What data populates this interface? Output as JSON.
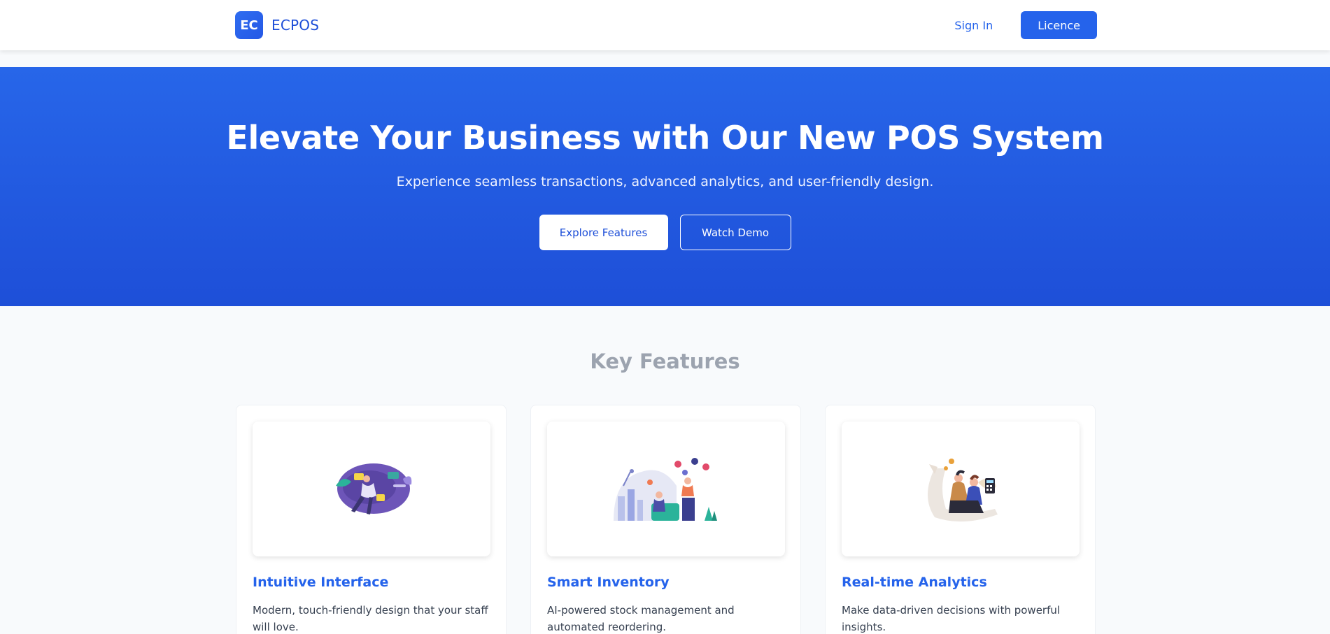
{
  "header": {
    "logo_text": "EC",
    "brand_name": "ECPOS",
    "sign_in_label": "Sign In",
    "licence_label": "Licence"
  },
  "hero": {
    "title": "Elevate Your Business with Our New POS System",
    "subtitle": "Experience seamless transactions, advanced analytics, and user-friendly design.",
    "primary_button": "Explore Features",
    "secondary_button": "Watch Demo"
  },
  "features": {
    "title": "Key Features",
    "items": [
      {
        "title": "Intuitive Interface",
        "description": "Modern, touch-friendly design that your staff will love.",
        "illustration": "person-floating-illustration"
      },
      {
        "title": "Smart Inventory",
        "description": "AI-powered stock management and automated reordering.",
        "illustration": "team-inventory-illustration"
      },
      {
        "title": "Real-time Analytics",
        "description": "Make data-driven decisions with powerful insights.",
        "illustration": "analytics-people-illustration"
      }
    ]
  },
  "colors": {
    "primary": "#2563eb",
    "hero_top": "#2766e9",
    "hero_bottom": "#1e4fd8",
    "page_background": "#f8fafc",
    "muted_heading": "#9ca3af"
  }
}
